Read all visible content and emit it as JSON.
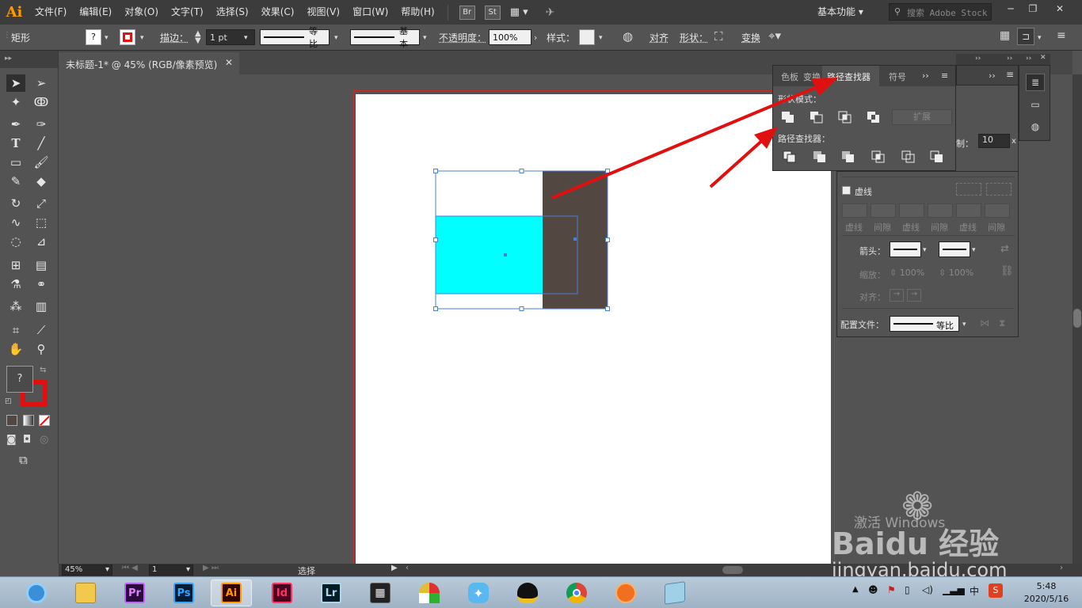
{
  "app": {
    "logo": "Ai",
    "menu": [
      "文件(F)",
      "编辑(E)",
      "对象(O)",
      "文字(T)",
      "选择(S)",
      "效果(C)",
      "视图(V)",
      "窗口(W)",
      "帮助(H)"
    ],
    "bridge_label": "Br",
    "stock_label": "St",
    "workspace": "基本功能",
    "search_placeholder": "搜索 Adobe Stock"
  },
  "control_bar": {
    "object_type": "矩形",
    "stroke_label": "描边：",
    "stroke_weight": "1 pt",
    "stroke_profile": "等比",
    "brush": "基本",
    "opacity_label": "不透明度：",
    "opacity_value": "100%",
    "style_label": "样式：",
    "align_label": "对齐",
    "shape_label": "形状：",
    "transform_label": "变换"
  },
  "document": {
    "tab_title": "未标题-1* @ 45% (RGB/像素预览)",
    "zoom": "45%",
    "page": "1",
    "status": "选择"
  },
  "pathfinder_panel": {
    "tabs": [
      "色板",
      "变换",
      "路径查找器",
      "符号"
    ],
    "active_tab": "路径查找器",
    "shape_modes_label": "形状模式：",
    "pathfinders_label": "路径查找器：",
    "expand_label": "扩展"
  },
  "stroke_panel": {
    "limit_label": "制：",
    "limit_value": "10",
    "limit_unit": "x",
    "dashed_label": "虚线",
    "dash_labels": [
      "虚线",
      "间隙",
      "虚线",
      "间隙",
      "虚线",
      "间隙"
    ],
    "arrow_label": "箭头：",
    "scale_label": "缩放：",
    "scale_value_1": "100%",
    "scale_value_2": "100%",
    "align_label": "对齐：",
    "profile_label": "配置文件：",
    "profile_value": "等比"
  },
  "colors": {
    "cyan_rect": "#00ffff",
    "brown_rect": "#534741",
    "selection": "#4a7fd6",
    "arrow": "#e01010",
    "ai_orange": "#ff9a00"
  },
  "watermark": {
    "activate": "激活 Windows",
    "brand": "Baidu 经验",
    "domain": "jingyan.baidu.com"
  },
  "taskbar": {
    "apps": [
      {
        "name": "browser-360",
        "label": ""
      },
      {
        "name": "file-explorer",
        "label": ""
      },
      {
        "name": "premiere",
        "label": "Pr"
      },
      {
        "name": "photoshop",
        "label": "Ps"
      },
      {
        "name": "illustrator",
        "label": "Ai"
      },
      {
        "name": "indesign",
        "label": "Id"
      },
      {
        "name": "lightroom",
        "label": "Lr"
      },
      {
        "name": "video-player",
        "label": ""
      },
      {
        "name": "umbrella-app",
        "label": ""
      },
      {
        "name": "bird-app",
        "label": ""
      },
      {
        "name": "qq",
        "label": ""
      },
      {
        "name": "chrome",
        "label": ""
      },
      {
        "name": "fox-app",
        "label": ""
      },
      {
        "name": "notepad",
        "label": ""
      }
    ],
    "ime": "中",
    "time": "5:48",
    "date": "2020/5/16"
  }
}
